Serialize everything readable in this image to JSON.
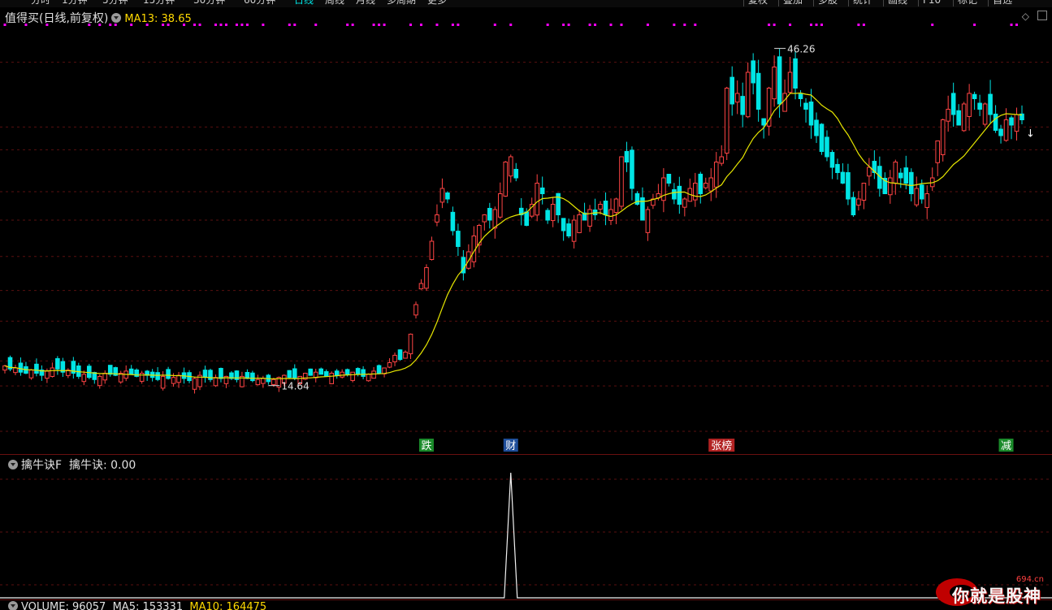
{
  "toolbar": {
    "periods": [
      "分时",
      "1分钟",
      "5分钟",
      "15分钟",
      "30分钟",
      "60分钟",
      "日线",
      "周线",
      "月线",
      "多周期",
      "更多"
    ],
    "active_period": "日线",
    "right_buttons": [
      "复权",
      "叠加",
      "多股",
      "统计",
      "画线",
      "F10",
      "标记",
      "自选"
    ]
  },
  "main_panel": {
    "indicator_name": "值得买(日线,前复权)",
    "ma_label": "MA13: 38.65",
    "high_label": "46.26",
    "low_label": "14.64",
    "events": [
      {
        "text": "跌",
        "color": "#1a8a2a",
        "index": 80
      },
      {
        "text": "财",
        "color": "#1f4e9a",
        "index": 96
      },
      {
        "text": "张榜",
        "color": "#b22222",
        "index": 136
      },
      {
        "text": "减",
        "color": "#1a8a2a",
        "index": 190
      }
    ],
    "colors": {
      "up": "#ff4444",
      "down": "#00e5e5",
      "ma": "#e6e600",
      "marker": "#ff00ff",
      "grid": "#5a0f0f"
    }
  },
  "sub_panel": {
    "indicator_name": "擒牛诀F",
    "value_label": "擒牛诀: 0.00",
    "spike_index": 96
  },
  "volume_bar": {
    "volume_label": "VOLUME: 96057",
    "ma5_label": "MA5: 153331",
    "ma10_label": "MA10: 164475"
  },
  "watermark": {
    "text": "你就是股神",
    "domain": "694.cn"
  },
  "chart_data": {
    "type": "candlestick",
    "title": "值得买(日线,前复权)",
    "ylim": [
      10,
      48
    ],
    "price_high": 46.26,
    "price_low": 14.64,
    "ma13_last": 38.65,
    "closes": [
      16.2,
      15.9,
      16.0,
      15.6,
      15.5,
      15.8,
      15.5,
      15.3,
      15.7,
      16.0,
      15.9,
      15.6,
      15.8,
      15.5,
      15.2,
      15.4,
      15.1,
      14.9,
      15.2,
      15.5,
      15.4,
      15.3,
      15.5,
      15.7,
      15.4,
      15.2,
      15.5,
      15.3,
      15.1,
      14.9,
      15.2,
      15.0,
      15.1,
      15.3,
      15.0,
      14.8,
      15.0,
      15.3,
      15.1,
      14.9,
      15.1,
      15.0,
      15.2,
      15.0,
      14.9,
      15.2,
      15.0,
      14.8,
      14.9,
      15.0,
      14.7,
      14.9,
      15.1,
      15.3,
      15.1,
      15.0,
      15.2,
      15.5,
      15.3,
      15.6,
      15.4,
      15.2,
      15.5,
      15.3,
      15.6,
      15.4,
      15.6,
      15.4,
      15.2,
      15.4,
      15.7,
      15.5,
      16.0,
      16.5,
      17.2,
      16.8,
      17.5,
      19.2,
      22.0,
      24.0,
      25.5,
      28.0,
      30.5,
      33.0,
      32.0,
      29.0,
      27.5,
      25.0,
      27.0,
      28.5,
      29.5,
      30.5,
      30.0,
      31.0,
      32.5,
      35.5,
      36.0,
      34.0,
      30.5,
      29.5,
      31.5,
      33.5,
      32.5,
      30.0,
      31.5,
      30.5,
      29.0,
      28.5,
      30.0,
      30.5,
      30.0,
      31.0,
      30.5,
      31.5,
      30.5,
      31.0,
      32.0,
      36.0,
      35.5,
      33.0,
      31.5,
      30.0,
      31.0,
      32.0,
      32.5,
      34.0,
      33.5,
      32.0,
      31.5,
      32.0,
      33.0,
      33.5,
      32.5,
      33.5,
      34.0,
      35.5,
      36.0,
      42.5,
      41.0,
      42.0,
      40.0,
      44.0,
      43.0,
      40.5,
      39.0,
      42.5,
      44.5,
      41.0,
      42.0,
      44.0,
      42.5,
      41.5,
      40.5,
      39.0,
      38.0,
      36.5,
      36.0,
      35.0,
      34.5,
      33.5,
      32.0,
      30.5,
      32.0,
      33.5,
      35.0,
      34.5,
      33.0,
      32.5,
      34.0,
      35.5,
      34.0,
      33.5,
      32.5,
      33.0,
      32.0,
      32.5,
      34.0,
      37.5,
      39.5,
      40.5,
      40.0,
      39.0,
      41.0,
      42.0,
      41.5,
      40.5,
      41.0,
      40.0,
      38.5,
      38.0,
      39.5,
      39.0,
      40.0,
      39.5
    ]
  }
}
